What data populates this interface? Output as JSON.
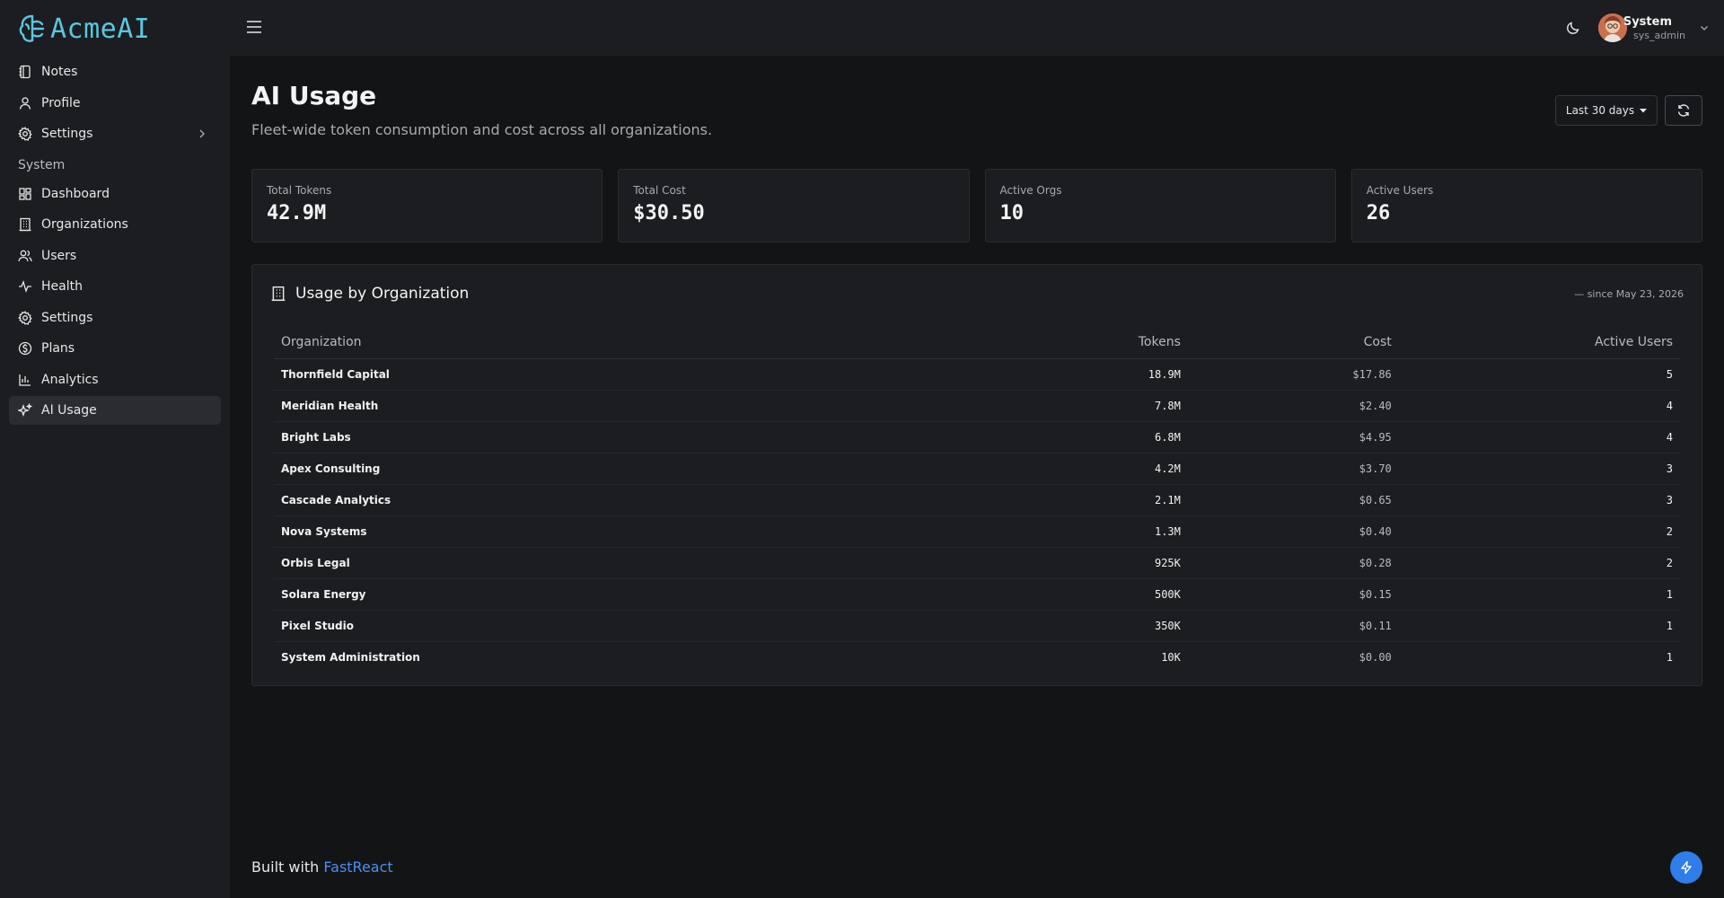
{
  "brand": {
    "name": "AcmeAI"
  },
  "sidebar": {
    "items": [
      {
        "label": "Notes",
        "icon": "notebook-icon"
      },
      {
        "label": "Profile",
        "icon": "user-icon"
      },
      {
        "label": "Settings",
        "icon": "gear-icon"
      }
    ],
    "section_label": "System",
    "system_items": [
      {
        "label": "Dashboard",
        "icon": "grid-icon"
      },
      {
        "label": "Organizations",
        "icon": "building-icon"
      },
      {
        "label": "Users",
        "icon": "users-icon"
      },
      {
        "label": "Health",
        "icon": "activity-icon"
      },
      {
        "label": "Settings",
        "icon": "gear-icon"
      },
      {
        "label": "Plans",
        "icon": "dollar-circle-icon"
      },
      {
        "label": "Analytics",
        "icon": "bar-chart-icon"
      },
      {
        "label": "AI Usage",
        "icon": "sparkles-icon",
        "active": true
      }
    ]
  },
  "header": {
    "user": {
      "name": "System",
      "role": "sys_admin"
    }
  },
  "page": {
    "title": "AI Usage",
    "subtitle": "Fleet-wide token consumption and cost across all organizations.",
    "range_label": "Last 30 days"
  },
  "stats": [
    {
      "label": "Total Tokens",
      "value": "42.9M"
    },
    {
      "label": "Total Cost",
      "value": "$30.50"
    },
    {
      "label": "Active Orgs",
      "value": "10"
    },
    {
      "label": "Active Users",
      "value": "26"
    }
  ],
  "usage": {
    "title": "Usage by Organization",
    "since": "— since May 23, 2026",
    "columns": [
      "Organization",
      "Tokens",
      "Cost",
      "Active Users"
    ],
    "rows": [
      {
        "org": "Thornfield Capital",
        "tokens": "18.9M",
        "cost": "$17.86",
        "users": "5"
      },
      {
        "org": "Meridian Health",
        "tokens": "7.8M",
        "cost": "$2.40",
        "users": "4"
      },
      {
        "org": "Bright Labs",
        "tokens": "6.8M",
        "cost": "$4.95",
        "users": "4"
      },
      {
        "org": "Apex Consulting",
        "tokens": "4.2M",
        "cost": "$3.70",
        "users": "3"
      },
      {
        "org": "Cascade Analytics",
        "tokens": "2.1M",
        "cost": "$0.65",
        "users": "3"
      },
      {
        "org": "Nova Systems",
        "tokens": "1.3M",
        "cost": "$0.40",
        "users": "2"
      },
      {
        "org": "Orbis Legal",
        "tokens": "925K",
        "cost": "$0.28",
        "users": "2"
      },
      {
        "org": "Solara Energy",
        "tokens": "500K",
        "cost": "$0.15",
        "users": "1"
      },
      {
        "org": "Pixel Studio",
        "tokens": "350K",
        "cost": "$0.11",
        "users": "1"
      },
      {
        "org": "System Administration",
        "tokens": "10K",
        "cost": "$0.00",
        "users": "1"
      }
    ]
  },
  "footer": {
    "prefix": "Built with ",
    "link": "FastReact"
  },
  "colors": {
    "accent": "#4a90f0",
    "brand": "#5cc6e0",
    "fab": "#2f7dea"
  }
}
